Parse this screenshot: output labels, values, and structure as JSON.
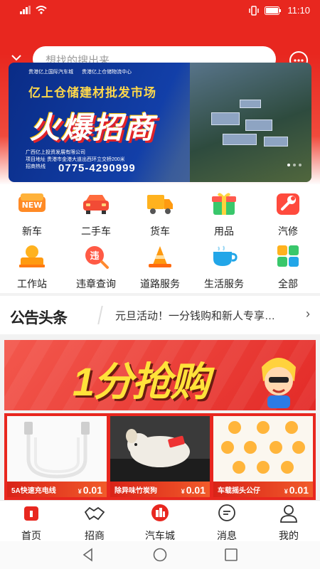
{
  "status": {
    "time": "11:10"
  },
  "search": {
    "placeholder": "想找的搜出来"
  },
  "banner": {
    "logo_left": "贵港亿上国际汽车城",
    "logo_right": "贵港亿上仓储物流中心",
    "title": "亿上仓储建材批发市场",
    "headline": "火爆招商",
    "company": "广西亿上投资发展有限公司",
    "address_label": "项目地址",
    "address": "贵港市金港大道出西环立交桥200米",
    "phone_label": "招商热线",
    "phone": "0775-4290999"
  },
  "grid": [
    {
      "label": "新车",
      "icon": "new-car-icon",
      "badge": "NEW"
    },
    {
      "label": "二手车",
      "icon": "used-car-icon"
    },
    {
      "label": "货车",
      "icon": "truck-icon"
    },
    {
      "label": "用品",
      "icon": "accessories-icon"
    },
    {
      "label": "汽修",
      "icon": "wrench-icon"
    },
    {
      "label": "工作站",
      "icon": "workstation-icon"
    },
    {
      "label": "违章查询",
      "icon": "violation-search-icon",
      "badge": "违"
    },
    {
      "label": "道路服务",
      "icon": "traffic-cone-icon"
    },
    {
      "label": "生活服务",
      "icon": "coffee-cup-icon"
    },
    {
      "label": "全部",
      "icon": "all-grid-icon"
    }
  ],
  "news": {
    "logo": "公告头条",
    "text": "元旦活动！一分钱购和新人专享…"
  },
  "promo": {
    "text": "1分抢购"
  },
  "products": [
    {
      "name": "5A快速充电线",
      "currency": "¥",
      "price": "0.01"
    },
    {
      "name": "除异味竹炭狗",
      "currency": "¥",
      "price": "0.01"
    },
    {
      "name": "车载摇头公仔",
      "currency": "¥",
      "price": "0.01"
    }
  ],
  "tabs": [
    {
      "label": "首页",
      "icon": "home-icon"
    },
    {
      "label": "招商",
      "icon": "handshake-icon"
    },
    {
      "label": "汽车城",
      "icon": "car-city-icon"
    },
    {
      "label": "消息",
      "icon": "message-icon"
    },
    {
      "label": "我的",
      "icon": "profile-icon"
    }
  ],
  "colors": {
    "accent": "#e8271f",
    "banner_blue": "#123fa8",
    "promo_yellow": "#ffe23a"
  }
}
